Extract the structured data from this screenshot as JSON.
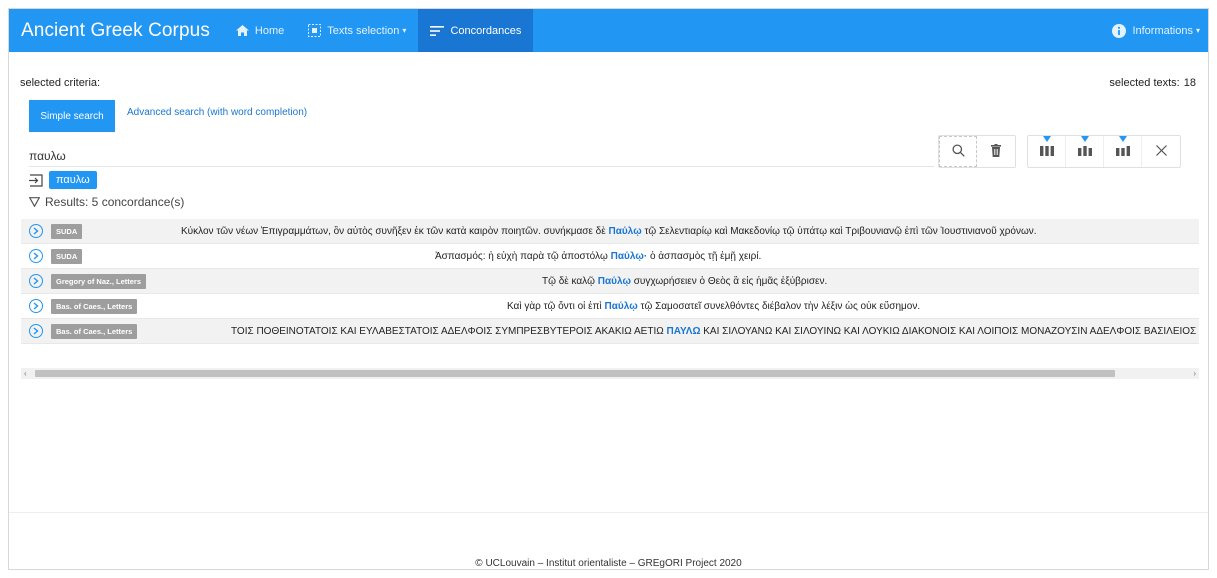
{
  "navbar": {
    "brand": "Ancient Greek Corpus",
    "items": [
      {
        "label": "Home",
        "icon": "home-icon"
      },
      {
        "label": "Texts selection",
        "icon": "selection-icon",
        "dropdown": true
      },
      {
        "label": "Concordances",
        "icon": "sort-lines-icon",
        "active": true
      }
    ],
    "info": {
      "label": "Informations",
      "icon": "info-circle-icon"
    },
    "colors": {
      "bar": "#2196f3",
      "active": "#1976d2"
    }
  },
  "criteria": {
    "label": "selected criteria:",
    "selected_texts_label": "selected texts:",
    "selected_texts_count": "18"
  },
  "search": {
    "tab_simple": "Simple search",
    "tab_advanced": "Advanced search (with word completion)",
    "query": "παυλω",
    "token": "παυλω",
    "results_label": "Results: 5 concordance(s)"
  },
  "toolbar": {
    "buttons": [
      "search-icon",
      "delete-icon",
      "columns-left-icon",
      "columns-center-icon",
      "columns-right-icon",
      "close-icon"
    ]
  },
  "concordances": [
    {
      "source": "SUDA",
      "left": "Κύκλον τῶν νέων Ἐπιγραμμάτων, ὃν αὐτὸς συνῆξεν ἐκ τῶν κατὰ καιρὸν ποιητῶν. συνήκμασε δὲ",
      "keyword": "Παύλῳ",
      "right": "τῷ Σελεντιαρίῳ καὶ Μακεδονίῳ τῷ ὑπάτῳ καὶ Τριβουνιανῷ ἐπὶ τῶν Ἰουστινιανοῦ χρόνων."
    },
    {
      "source": "SUDA",
      "left": "Ἀσπασμός: ἡ εὐχὴ παρὰ τῷ ἀποστόλῳ",
      "keyword": "Παύλῳ·",
      "right": "ὁ ἀσπασμὸς τῇ ἐμῇ χειρί."
    },
    {
      "source": "Gregory of Naz., Letters",
      "left": "Τῷ δὲ καλῷ",
      "keyword": "Παύλῳ",
      "right": "συγχωρήσειεν ὁ Θεὸς ἃ εἰς ἡμᾶς ἐξύβρισεν."
    },
    {
      "source": "Bas. of Caes., Letters",
      "left": "Καὶ γὰρ τῷ ὄντι οἱ ἐπὶ",
      "keyword": "Παύλῳ",
      "right": "τῷ Σαμοσατεῖ συνελθόντες διέβαλον τὴν λέξιν ὡς οὐκ εὔσημον."
    },
    {
      "source": "Bas. of Caes., Letters",
      "left": "ΤΟΙΣ ΠΟΘΕΙΝΟΤΑΤΟΙΣ ΚΑΙ ΕΥΛΑΒΕΣΤΑΤΟΙΣ ΑΔΕΛΦΟΙΣ ΣΥΜΠΡΕΣΒΥΤΕΡΟΙΣ ΑΚΑΚΙΩ ΑΕΤΙΩ",
      "keyword": "ΠΑΥΛΩ",
      "right": "ΚΑΙ ΣΙΛΟΥΑΝΩ ΚΑΙ ΣΙΛΟΥΙΝΩ ΚΑΙ ΛΟΥΚΙΩ ΔΙΑΚΟΝΟΙΣ ΚΑΙ ΛΟΙΠΟΙΣ ΜΟΝΑΖΟΥΣΙΝ ΑΔΕΛΦΟΙΣ ΒΑΣΙΛΕΙΟΣ ΕΠΙΣΚΟΠΟΣ Ἐγὼ ἀ"
    }
  ],
  "footer": {
    "text": "© UCLouvain – Institut orientaliste – GREgORI Project 2020"
  }
}
